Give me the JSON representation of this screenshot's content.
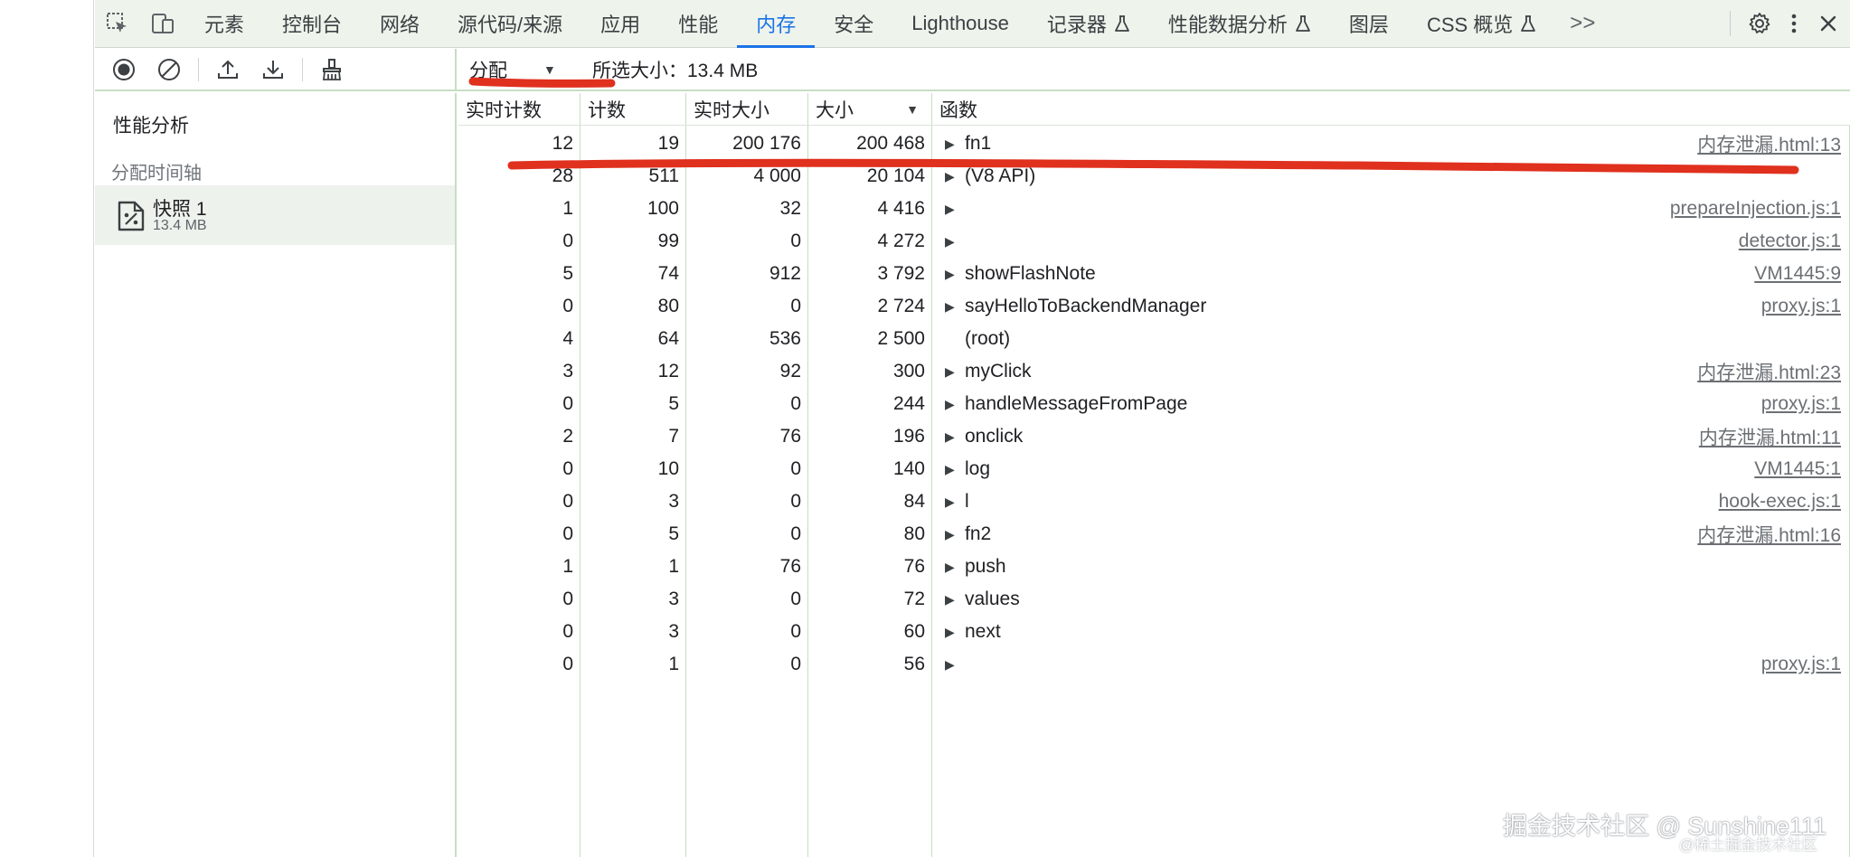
{
  "tabs": [
    {
      "label": "元素",
      "active": false,
      "experimental": false
    },
    {
      "label": "控制台",
      "active": false,
      "experimental": false
    },
    {
      "label": "网络",
      "active": false,
      "experimental": false
    },
    {
      "label": "源代码/来源",
      "active": false,
      "experimental": false
    },
    {
      "label": "应用",
      "active": false,
      "experimental": false
    },
    {
      "label": "性能",
      "active": false,
      "experimental": false
    },
    {
      "label": "内存",
      "active": true,
      "experimental": false
    },
    {
      "label": "安全",
      "active": false,
      "experimental": false
    },
    {
      "label": "Lighthouse",
      "active": false,
      "experimental": false
    },
    {
      "label": "记录器",
      "active": false,
      "experimental": true
    },
    {
      "label": "性能数据分析",
      "active": false,
      "experimental": true
    },
    {
      "label": "图层",
      "active": false,
      "experimental": false
    },
    {
      "label": "CSS 概览",
      "active": false,
      "experimental": true
    }
  ],
  "more_tabs": ">>",
  "toolbar": {
    "view": "分配",
    "selected_size": "所选大小：13.4 MB"
  },
  "sidebar": {
    "title": "性能分析",
    "section": "分配时间轴",
    "snapshot": {
      "name": "快照 1",
      "size": "13.4 MB"
    }
  },
  "columns": [
    "实时计数",
    "计数",
    "实时大小",
    "大小",
    "函数"
  ],
  "rows": [
    {
      "live_count": "12",
      "count": "19",
      "live_size": "200 176",
      "size": "200 468",
      "expandable": true,
      "function": "fn1",
      "source": "内存泄漏.html:13"
    },
    {
      "live_count": "28",
      "count": "511",
      "live_size": "4 000",
      "size": "20 104",
      "expandable": true,
      "function": "(V8 API)",
      "source": ""
    },
    {
      "live_count": "1",
      "count": "100",
      "live_size": "32",
      "size": "4 416",
      "expandable": true,
      "function": "",
      "source": "prepareInjection.js:1"
    },
    {
      "live_count": "0",
      "count": "99",
      "live_size": "0",
      "size": "4 272",
      "expandable": true,
      "function": "",
      "source": "detector.js:1"
    },
    {
      "live_count": "5",
      "count": "74",
      "live_size": "912",
      "size": "3 792",
      "expandable": true,
      "function": "showFlashNote",
      "source": "VM1445:9"
    },
    {
      "live_count": "0",
      "count": "80",
      "live_size": "0",
      "size": "2 724",
      "expandable": true,
      "function": "sayHelloToBackendManager",
      "source": "proxy.js:1"
    },
    {
      "live_count": "4",
      "count": "64",
      "live_size": "536",
      "size": "2 500",
      "expandable": false,
      "function": "(root)",
      "source": ""
    },
    {
      "live_count": "3",
      "count": "12",
      "live_size": "92",
      "size": "300",
      "expandable": true,
      "function": "myClick",
      "source": "内存泄漏.html:23"
    },
    {
      "live_count": "0",
      "count": "5",
      "live_size": "0",
      "size": "244",
      "expandable": true,
      "function": "handleMessageFromPage",
      "source": "proxy.js:1"
    },
    {
      "live_count": "2",
      "count": "7",
      "live_size": "76",
      "size": "196",
      "expandable": true,
      "function": "onclick",
      "source": "内存泄漏.html:11"
    },
    {
      "live_count": "0",
      "count": "10",
      "live_size": "0",
      "size": "140",
      "expandable": true,
      "function": "log",
      "source": "VM1445:1"
    },
    {
      "live_count": "0",
      "count": "3",
      "live_size": "0",
      "size": "84",
      "expandable": true,
      "function": "l",
      "source": "hook-exec.js:1"
    },
    {
      "live_count": "0",
      "count": "5",
      "live_size": "0",
      "size": "80",
      "expandable": true,
      "function": "fn2",
      "source": "内存泄漏.html:16"
    },
    {
      "live_count": "1",
      "count": "1",
      "live_size": "76",
      "size": "76",
      "expandable": true,
      "function": "push",
      "source": ""
    },
    {
      "live_count": "0",
      "count": "3",
      "live_size": "0",
      "size": "72",
      "expandable": true,
      "function": "values",
      "source": ""
    },
    {
      "live_count": "0",
      "count": "3",
      "live_size": "0",
      "size": "60",
      "expandable": true,
      "function": "next",
      "source": ""
    },
    {
      "live_count": "0",
      "count": "1",
      "live_size": "0",
      "size": "56",
      "expandable": true,
      "function": "",
      "source": "proxy.js:1"
    }
  ],
  "watermark": {
    "line1": "掘金技术社区 @ Sunshine111",
    "line2": "@稀土掘金技术社区"
  },
  "colors": {
    "accent": "#1a73e8",
    "annotation": "#e0301e",
    "divider": "#c7dec3"
  }
}
